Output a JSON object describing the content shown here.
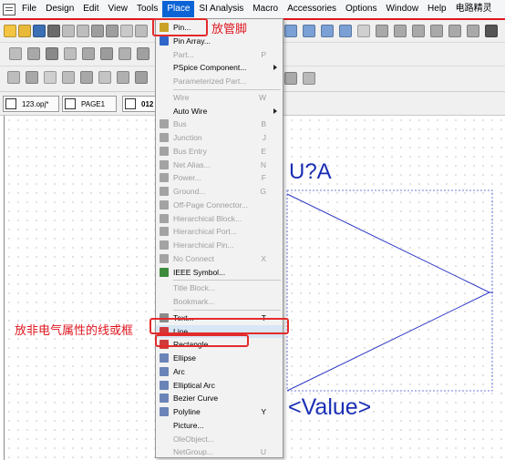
{
  "menubar": {
    "items": [
      "File",
      "Design",
      "Edit",
      "View",
      "Tools",
      "Place",
      "SI Analysis",
      "Macro",
      "Accessories",
      "Options",
      "Window",
      "Help",
      "电路精灵"
    ],
    "active_index": 5
  },
  "tabs": [
    {
      "label": "123.opj*",
      "icon": "project-icon"
    },
    {
      "label": "PAGE1",
      "icon": "page-icon"
    },
    {
      "label": "012",
      "icon": "schematic-icon"
    }
  ],
  "place_menu": {
    "items": [
      {
        "label": "Pin...",
        "shortcut": "",
        "enabled": true,
        "submenu": false,
        "icon": "pin-icon"
      },
      {
        "label": "Pin Array...",
        "shortcut": "",
        "enabled": true,
        "submenu": false,
        "icon": "pin-array-icon"
      },
      {
        "label": "Part...",
        "shortcut": "P",
        "enabled": false,
        "submenu": false,
        "icon": ""
      },
      {
        "label": "PSpice Component...",
        "shortcut": "",
        "enabled": true,
        "submenu": true,
        "icon": ""
      },
      {
        "label": "Parameterized Part...",
        "shortcut": "",
        "enabled": false,
        "submenu": false,
        "icon": ""
      },
      {
        "label": "Wire",
        "shortcut": "W",
        "enabled": false,
        "submenu": false,
        "icon": ""
      },
      {
        "label": "Auto Wire",
        "shortcut": "",
        "enabled": true,
        "submenu": true,
        "icon": ""
      },
      {
        "label": "Bus",
        "shortcut": "B",
        "enabled": false,
        "submenu": false,
        "icon": "bus-icon"
      },
      {
        "label": "Junction",
        "shortcut": "J",
        "enabled": false,
        "submenu": false,
        "icon": "junction-icon"
      },
      {
        "label": "Bus Entry",
        "shortcut": "E",
        "enabled": false,
        "submenu": false,
        "icon": "bus-entry-icon"
      },
      {
        "label": "Net Alias...",
        "shortcut": "N",
        "enabled": false,
        "submenu": false,
        "icon": "net-alias-icon"
      },
      {
        "label": "Power...",
        "shortcut": "F",
        "enabled": false,
        "submenu": false,
        "icon": "power-icon"
      },
      {
        "label": "Ground...",
        "shortcut": "G",
        "enabled": false,
        "submenu": false,
        "icon": "ground-icon"
      },
      {
        "label": "Off-Page Connector...",
        "shortcut": "",
        "enabled": false,
        "submenu": false,
        "icon": "off-page-connector-icon"
      },
      {
        "label": "Hierarchical Block...",
        "shortcut": "",
        "enabled": false,
        "submenu": false,
        "icon": "hierarchical-block-icon"
      },
      {
        "label": "Hierarchical Port...",
        "shortcut": "",
        "enabled": false,
        "submenu": false,
        "icon": "hierarchical-port-icon"
      },
      {
        "label": "Hierarchical Pin...",
        "shortcut": "",
        "enabled": false,
        "submenu": false,
        "icon": "hierarchical-pin-icon"
      },
      {
        "label": "No Connect",
        "shortcut": "X",
        "enabled": false,
        "submenu": false,
        "icon": "no-connect-icon"
      },
      {
        "label": "IEEE Symbol...",
        "shortcut": "",
        "enabled": true,
        "submenu": false,
        "icon": "ieee-symbol-icon"
      },
      {
        "label": "Title Block...",
        "shortcut": "",
        "enabled": false,
        "submenu": false,
        "icon": ""
      },
      {
        "label": "Bookmark...",
        "shortcut": "",
        "enabled": false,
        "submenu": false,
        "icon": ""
      },
      {
        "label": "Text...",
        "shortcut": "T",
        "enabled": true,
        "submenu": false,
        "icon": "text-icon"
      },
      {
        "label": "Line",
        "shortcut": "",
        "enabled": true,
        "submenu": false,
        "icon": "line-icon"
      },
      {
        "label": "Rectangle",
        "shortcut": "",
        "enabled": true,
        "submenu": false,
        "icon": "rectangle-icon"
      },
      {
        "label": "Ellipse",
        "shortcut": "",
        "enabled": true,
        "submenu": false,
        "icon": "ellipse-icon"
      },
      {
        "label": "Arc",
        "shortcut": "",
        "enabled": true,
        "submenu": false,
        "icon": "arc-icon"
      },
      {
        "label": "Elliptical Arc",
        "shortcut": "",
        "enabled": true,
        "submenu": false,
        "icon": "elliptical-arc-icon"
      },
      {
        "label": "Bezier Curve",
        "shortcut": "",
        "enabled": true,
        "submenu": false,
        "icon": "bezier-curve-icon"
      },
      {
        "label": "Polyline",
        "shortcut": "Y",
        "enabled": true,
        "submenu": false,
        "icon": "polyline-icon"
      },
      {
        "label": "Picture...",
        "shortcut": "",
        "enabled": true,
        "submenu": false,
        "icon": ""
      },
      {
        "label": "OleObject...",
        "shortcut": "",
        "enabled": false,
        "submenu": false,
        "icon": ""
      },
      {
        "label": "NetGroup...",
        "shortcut": "U",
        "enabled": false,
        "submenu": false,
        "icon": ""
      }
    ]
  },
  "annotations": {
    "pin_note": "放管脚",
    "graphic_note": "放非电气属性的线或框"
  },
  "schematic": {
    "refdes": "U?A",
    "value": "<Value>"
  },
  "colors": {
    "accent": "#0b64d6",
    "annotation_red": "#e0161f",
    "schematic_blue": "#1b2fb5"
  }
}
